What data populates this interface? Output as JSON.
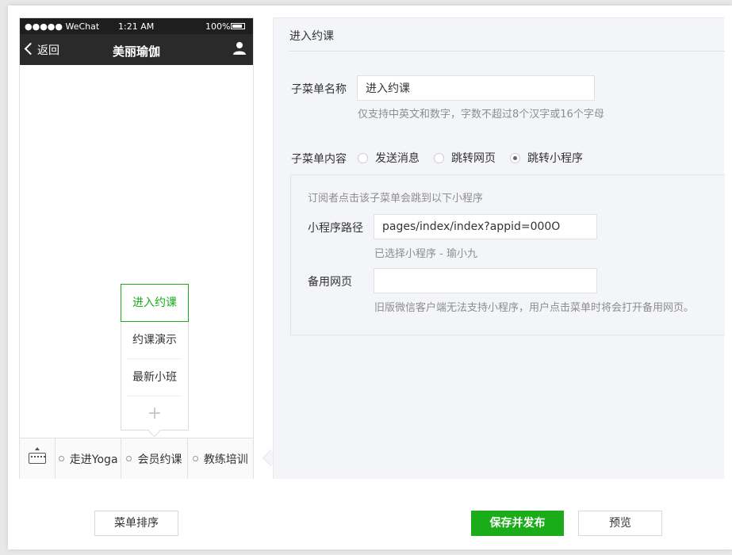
{
  "phone": {
    "status": {
      "signal": "●●●●● WeChat",
      "time": "1:21 AM",
      "battery": "100%"
    },
    "nav": {
      "back_label": "返回",
      "title": "美丽瑜伽"
    },
    "submenu": {
      "items": [
        "进入约课",
        "约课演示",
        "最新小班"
      ],
      "active_index": 0,
      "add_label": "+"
    },
    "bottom_menu": [
      "走进Yoga",
      "会员约课",
      "教练培训"
    ]
  },
  "editor": {
    "header": "进入约课",
    "name_label": "子菜单名称",
    "name_value": "进入约课",
    "name_hint": "仅支持中英文和数字，字数不超过8个汉字或16个字母",
    "content_label": "子菜单内容",
    "content_options": [
      "发送消息",
      "跳转网页",
      "跳转小程序"
    ],
    "content_selected": "跳转小程序",
    "miniprogram": {
      "intro": "订阅者点击该子菜单会跳到以下小程序",
      "path_label": "小程序路径",
      "path_value": "pages/index/index?appid=000O",
      "path_hint": "已选择小程序 - 瑜小九",
      "backup_label": "备用网页",
      "backup_value": "",
      "backup_hint": "旧版微信客户端无法支持小程序，用户点击菜单时将会打开备用网页。"
    }
  },
  "footer": {
    "sort_button": "菜单排序",
    "publish_button": "保存并发布",
    "preview_button": "预览"
  },
  "colors": {
    "accent": "#1aad19",
    "panel_bg": "#f4f5f9",
    "navbar_bg": "#2a2a2a"
  }
}
